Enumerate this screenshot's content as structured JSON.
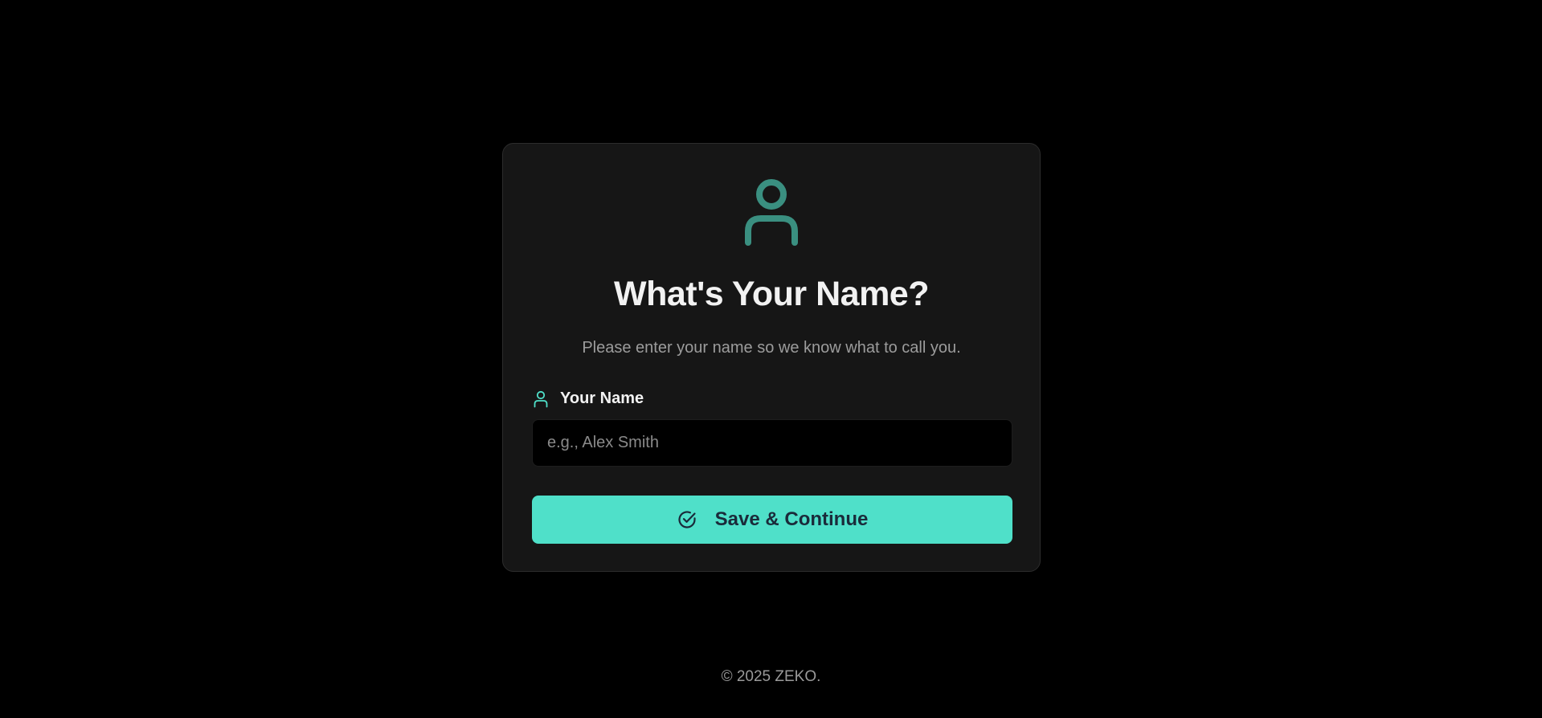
{
  "form": {
    "icon": "user-icon",
    "title": "What's Your Name?",
    "subtitle": "Please enter your name so we know what to call you.",
    "name_field": {
      "label": "Your Name",
      "label_icon": "user-icon",
      "value": "",
      "placeholder": "e.g., Alex Smith"
    },
    "submit": {
      "label": "Save & Continue",
      "icon": "check-circle-icon"
    }
  },
  "footer": {
    "copyright": "© 2025 ZEKO."
  },
  "colors": {
    "background": "#000000",
    "card": "#161616",
    "accent": "#4fe0c9",
    "hero_icon": "#3a8f80",
    "button_text": "#1a2b3a"
  }
}
